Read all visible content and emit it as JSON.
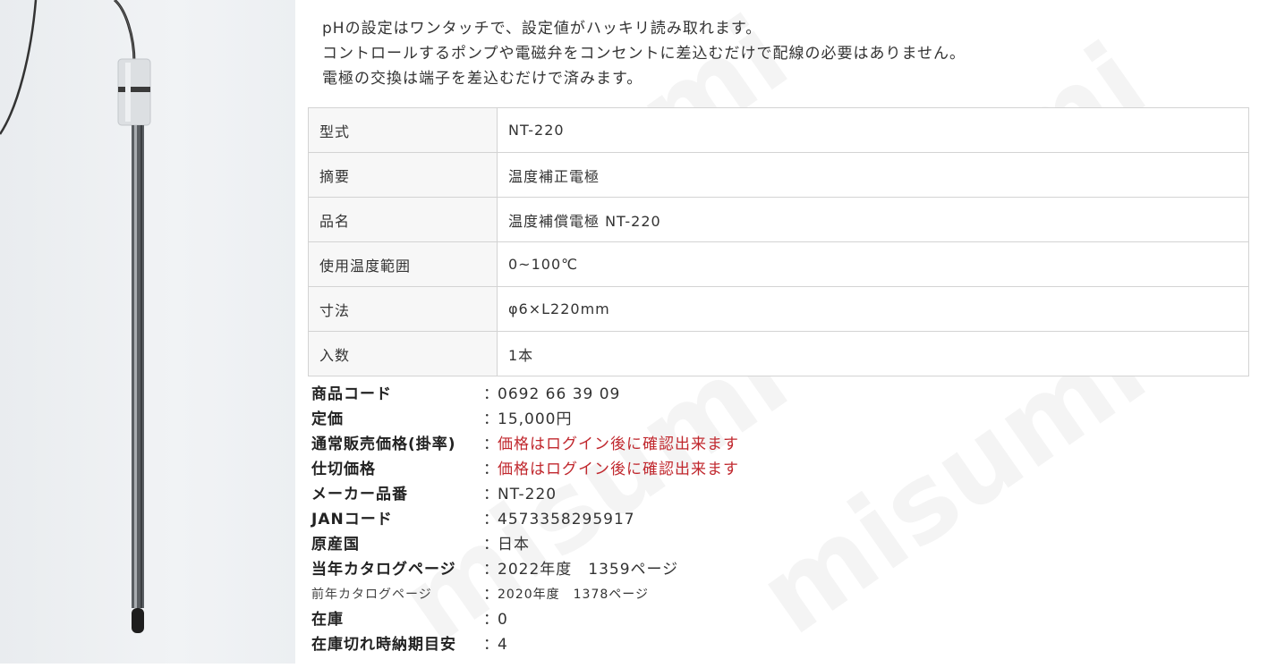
{
  "intro_lines": [
    "pHの設定はワンタッチで、設定値がハッキリ読み取れます。",
    "コントロールするポンプや電磁弁をコンセントに差込むだけで配線の必要はありません。",
    "電極の交換は端子を差込むだけで済みます。"
  ],
  "watermark": "misumi",
  "spec_table": [
    {
      "key": "型式",
      "value": "NT-220"
    },
    {
      "key": "摘要",
      "value": "温度補正電極"
    },
    {
      "key": "品名",
      "value": "温度補償電極 NT-220"
    },
    {
      "key": "使用温度範囲",
      "value": "0~100℃"
    },
    {
      "key": "寸法",
      "value": "φ6×L220mm"
    },
    {
      "key": "入数",
      "value": "1本"
    }
  ],
  "separator": "：",
  "info": [
    {
      "label": "商品コード",
      "value": "0692 66 39 09"
    },
    {
      "label": "定価",
      "value": "15,000円"
    },
    {
      "label": "通常販売価格(掛率)",
      "value": "価格はログイン後に確認出来ます"
    },
    {
      "label": "仕切価格",
      "value": "価格はログイン後に確認出来ます"
    },
    {
      "label": "メーカー品番",
      "value": "NT-220"
    },
    {
      "label": "JANコード",
      "value": "4573358295917"
    },
    {
      "label": "原産国",
      "value": "日本"
    },
    {
      "label": "当年カタログページ",
      "value": "2022年度　1359ページ"
    },
    {
      "label": "前年カタログページ",
      "value": "2020年度　1378ページ"
    },
    {
      "label": "在庫",
      "value": "0"
    },
    {
      "label": "在庫切れ時納期目安",
      "value": "4"
    }
  ],
  "colors": {
    "price_notice": "#c0272d",
    "border": "#d3d3d3"
  }
}
